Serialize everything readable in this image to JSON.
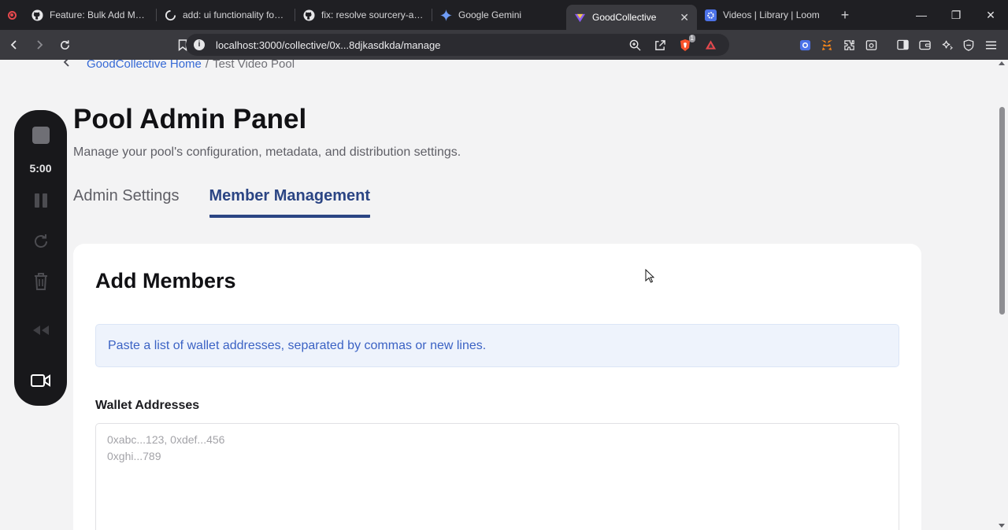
{
  "browser": {
    "tabs": [
      {
        "title": "Feature: Bulk Add Members",
        "icon": "github-icon"
      },
      {
        "title": "add: ui functionality for bulk",
        "icon": "git-pull-request-icon"
      },
      {
        "title": "fix: resolve sourcery-ai ne",
        "icon": "github-icon"
      },
      {
        "title": "Google Gemini",
        "icon": "gemini-icon"
      },
      {
        "title": "GoodCollective",
        "icon": "goodcollective-icon",
        "active": true
      },
      {
        "title": "Videos | Library | Loom",
        "icon": "loom-icon"
      }
    ],
    "new_tab": "+",
    "url": "localhost:3000/collective/0x...8djkasdkda/manage",
    "brave_badge": "1"
  },
  "breadcrumb": {
    "home": "GoodCollective Home",
    "separator": "/",
    "current": "Test Video Pool"
  },
  "page": {
    "title": "Pool Admin Panel",
    "subtitle": "Manage your pool's configuration, metadata, and distribution settings."
  },
  "tabs": {
    "admin_settings": "Admin Settings",
    "member_management": "Member Management",
    "active": "member_management"
  },
  "card": {
    "title": "Add Members",
    "info": "Paste a list of wallet addresses, separated by commas or new lines.",
    "field_label": "Wallet Addresses",
    "placeholder": "0xabc...123, 0xdef...456\n0xghi...789"
  },
  "recorder": {
    "timer": "5:00"
  },
  "colors": {
    "accent": "#2b4584",
    "link": "#3569d6",
    "info_bg": "#eef3fc",
    "info_text": "#3b62c4"
  }
}
